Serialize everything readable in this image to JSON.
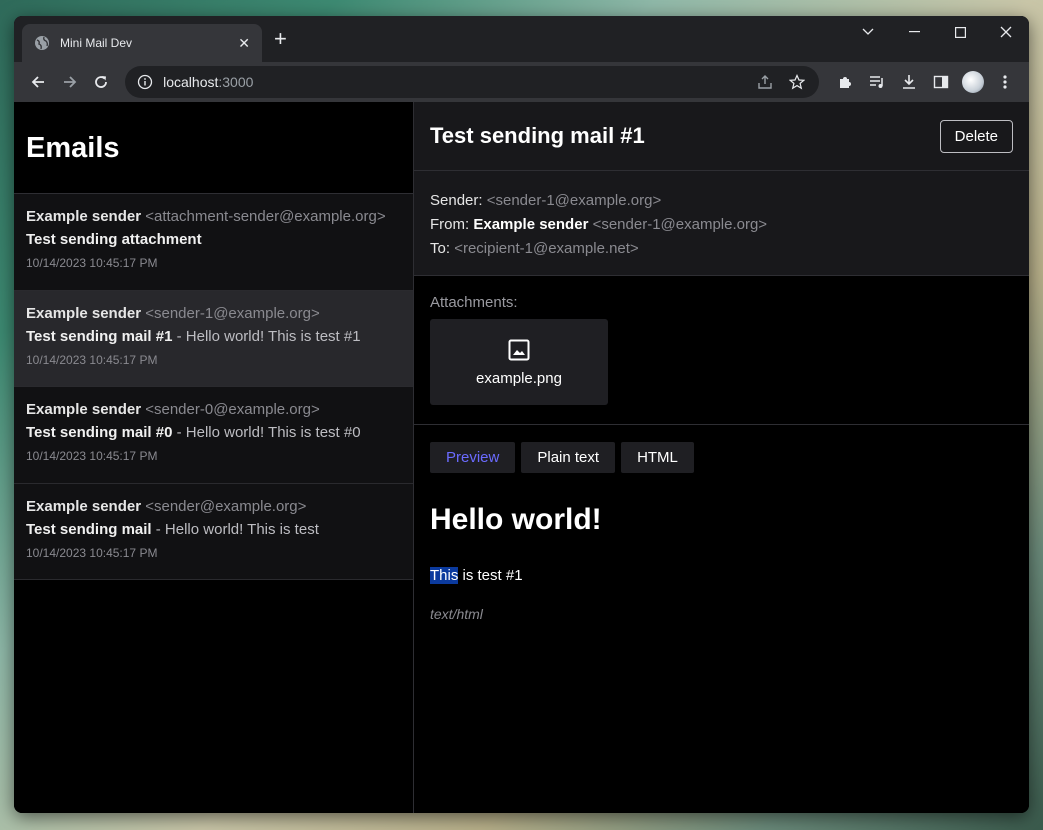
{
  "browser": {
    "tab_title": "Mini Mail Dev",
    "tab_close": "✕",
    "new_tab": "+",
    "url_host": "localhost",
    "url_port": ":3000"
  },
  "app": {
    "heading": "Emails",
    "emails": [
      {
        "sender_name": "Example sender",
        "sender_addr": "<attachment-sender@example.org>",
        "subject": "Test sending attachment",
        "preview": "",
        "date": "10/14/2023 10:45:17 PM"
      },
      {
        "sender_name": "Example sender",
        "sender_addr": "<sender-1@example.org>",
        "subject": "Test sending mail #1",
        "preview": " - Hello world! This is test #1",
        "date": "10/14/2023 10:45:17 PM"
      },
      {
        "sender_name": "Example sender",
        "sender_addr": "<sender-0@example.org>",
        "subject": "Test sending mail #0",
        "preview": " - Hello world! This is test #0",
        "date": "10/14/2023 10:45:17 PM"
      },
      {
        "sender_name": "Example sender",
        "sender_addr": "<sender@example.org>",
        "subject": "Test sending mail",
        "preview": " - Hello world! This is test",
        "date": "10/14/2023 10:45:17 PM"
      }
    ],
    "detail": {
      "title": "Test sending mail #1",
      "delete_label": "Delete",
      "sender_key": "Sender:",
      "sender_val": "<sender-1@example.org>",
      "from_key": "From:",
      "from_name": "Example sender",
      "from_addr": "<sender-1@example.org>",
      "to_key": "To:",
      "to_val": "<recipient-1@example.net>",
      "attachments_label": "Attachments:",
      "attachment_name": "example.png",
      "tabs": [
        "Preview",
        "Plain text",
        "HTML"
      ],
      "body_heading": "Hello world!",
      "body_selected": "This",
      "body_rest": " is test #1",
      "content_type": "text/html"
    }
  }
}
